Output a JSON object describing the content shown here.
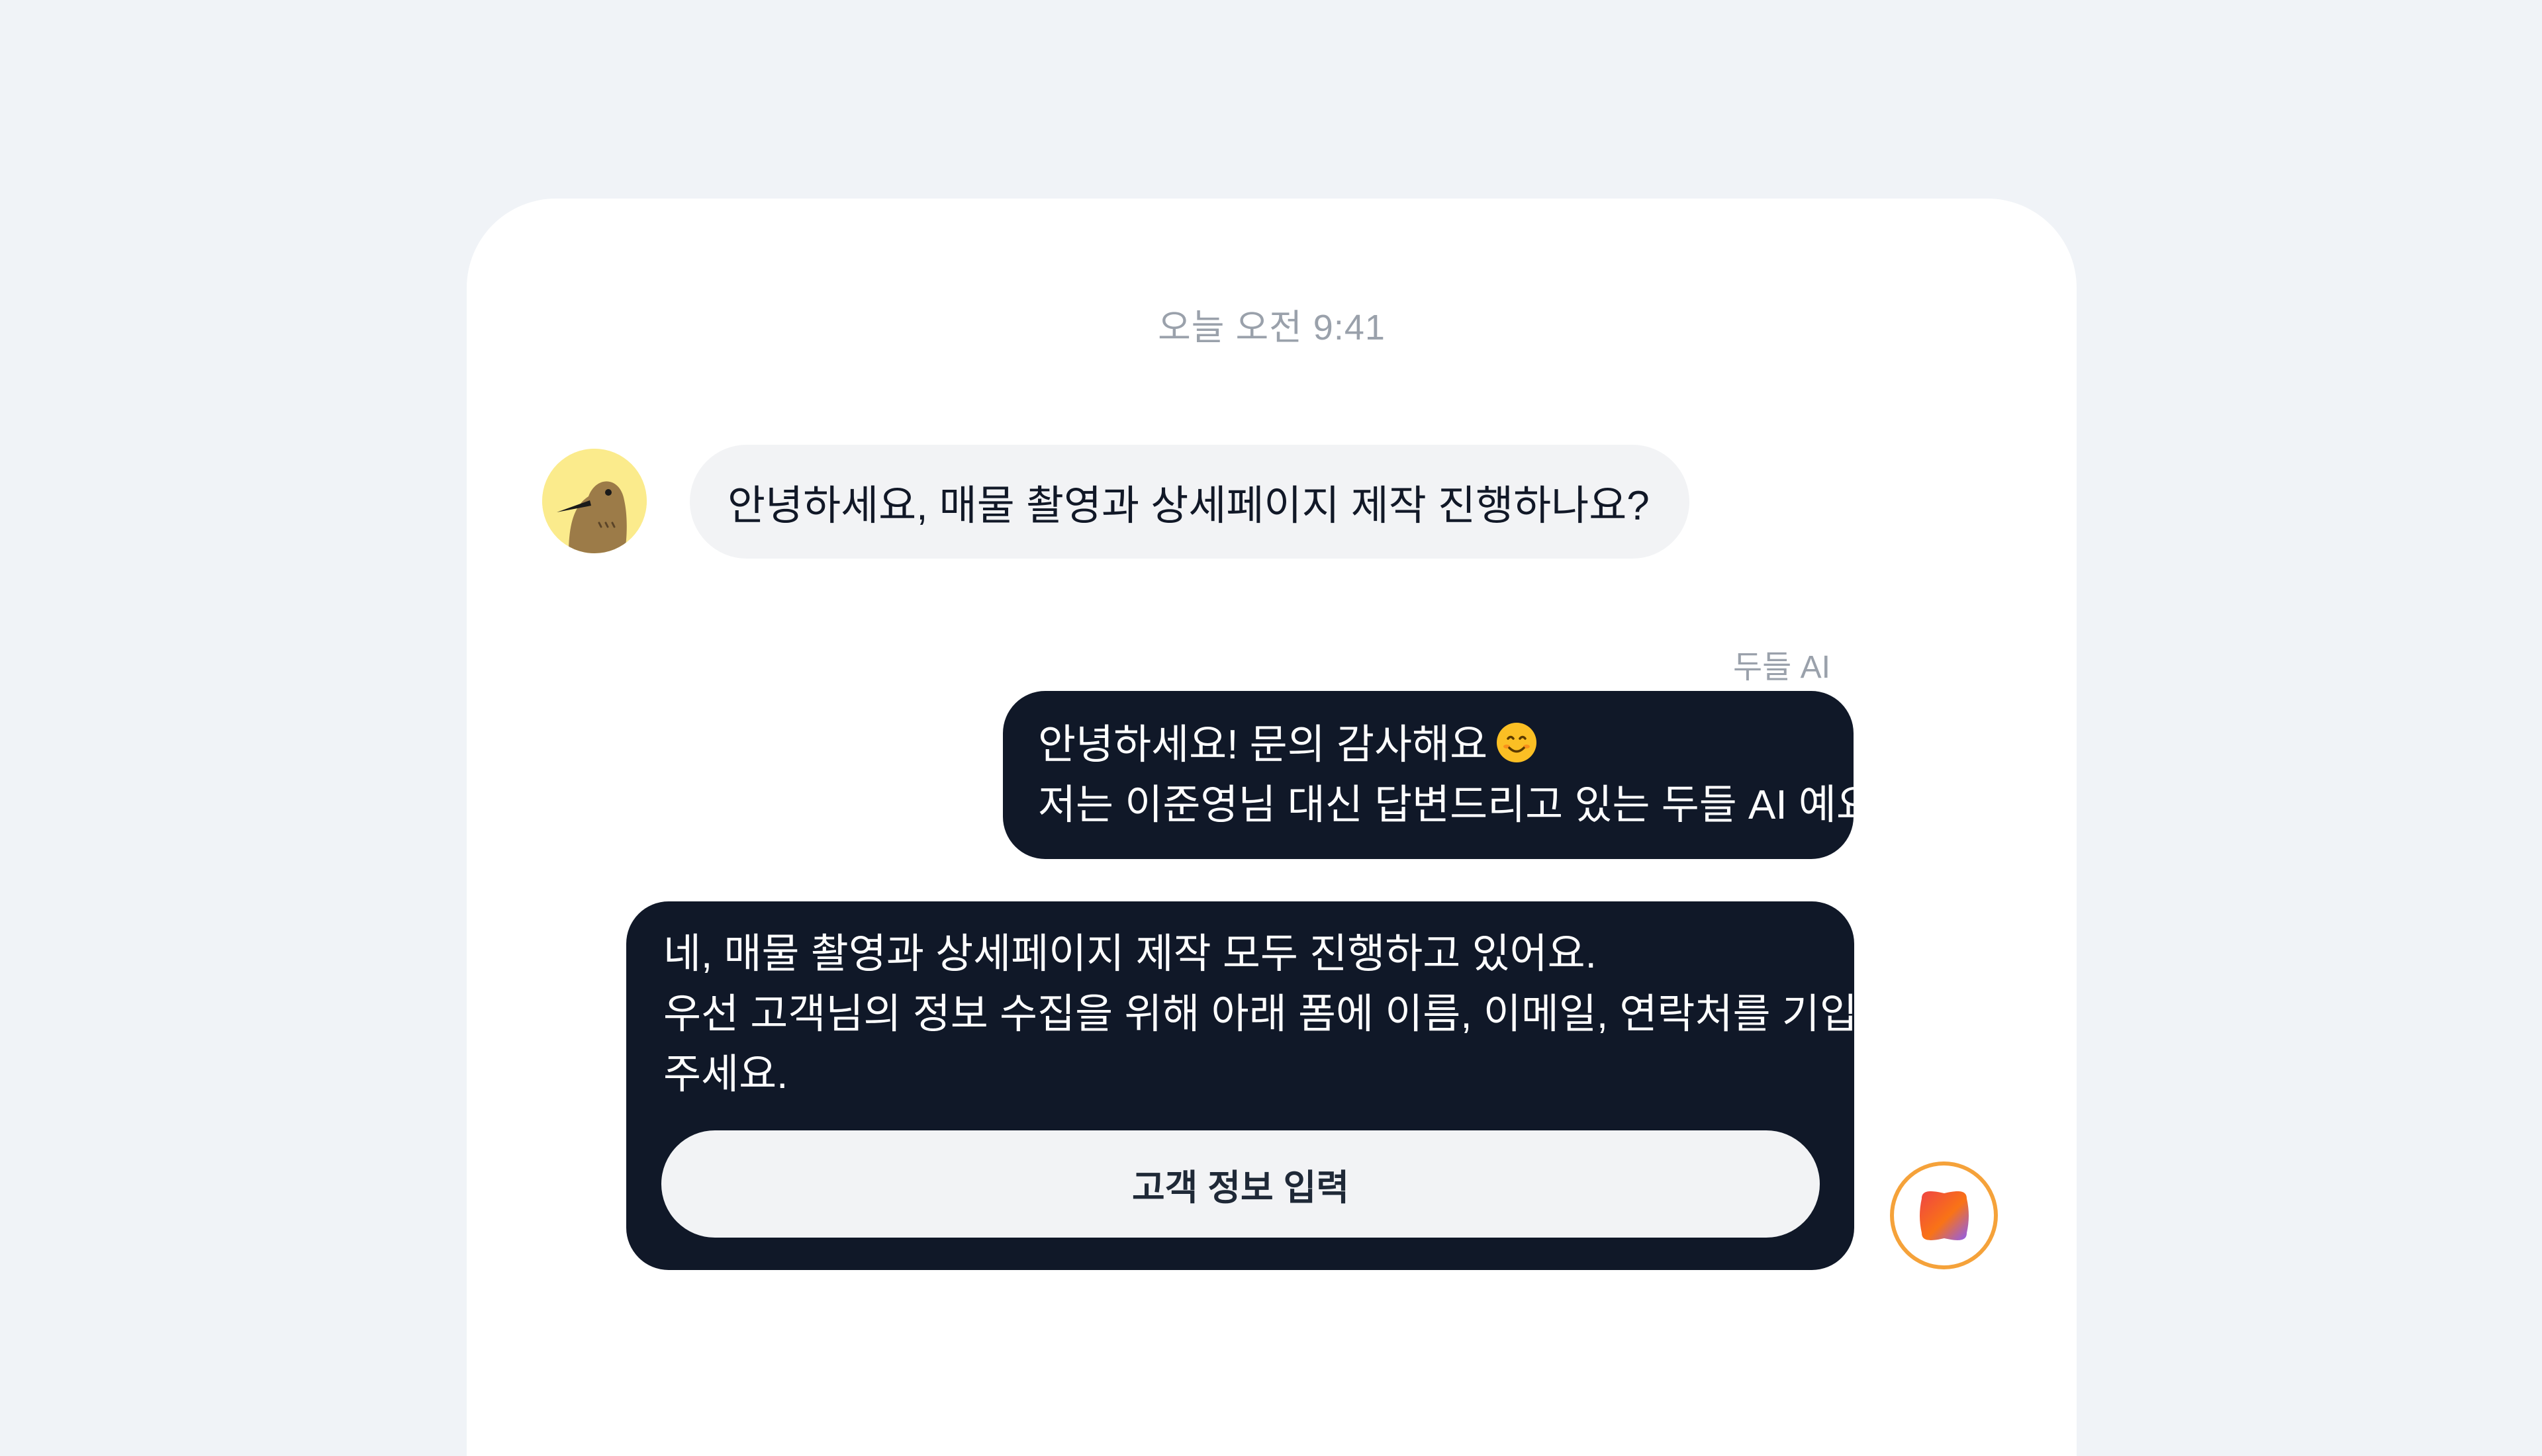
{
  "chat": {
    "timestamp": "오늘 오전 9:41",
    "user_message": "안녕하세요, 매물 촬영과 상세페이지 제작 진행하나요?",
    "ai_sender_name": "두들 AI",
    "ai_message_1": {
      "line1": "안녕하세요! 문의 감사해요",
      "emoji": "smiling-face-emoji",
      "line2": "저는 이준영님 대신 답변드리고 있는 두들 AI 예요."
    },
    "ai_message_2": {
      "line1": "네, 매물 촬영과 상세페이지 제작 모두 진행하고 있어요.",
      "line2": "우선 고객님의 정보 수집을 위해 아래 폼에 이름, 이메일, 연락처를 기입해",
      "line3": "주세요."
    },
    "cta_button_label": "고객 정보 입력"
  },
  "icons": {
    "user_avatar": "bird-avatar-icon",
    "ai_avatar": "doodle-ai-logo-icon"
  },
  "colors": {
    "page_background": "#f0f3f7",
    "card_background": "#ffffff",
    "user_bubble": "#f2f3f5",
    "ai_bubble": "#101828",
    "muted_text": "#9aa1ab",
    "ai_avatar_ring": "#f5a23a"
  }
}
